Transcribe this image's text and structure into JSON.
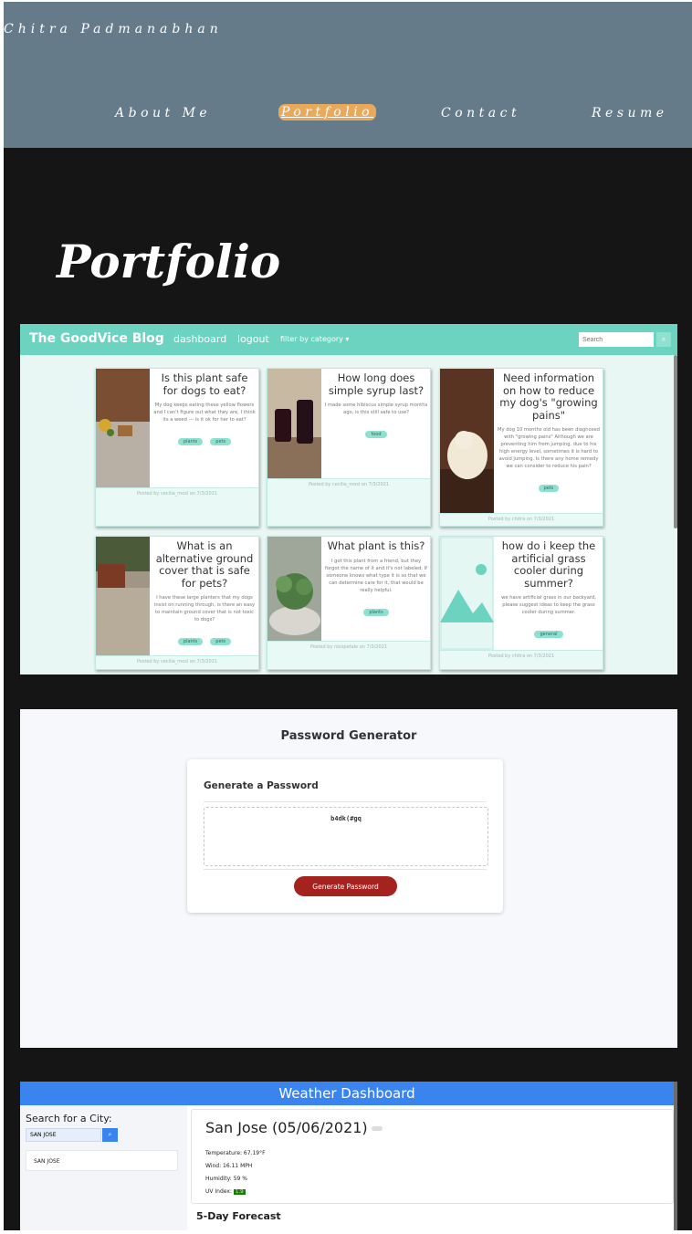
{
  "site": {
    "brand": "Chitra Padmanabhan",
    "nav": [
      "About Me",
      "Portfolio",
      "Contact",
      "Resume"
    ],
    "active_nav": "Portfolio",
    "page_title": "Portfolio",
    "colors": {
      "header_bg": "#667b8a",
      "page_bg": "#151515",
      "active_nav_bg": "#e8a95a"
    }
  },
  "blog_shot": {
    "brand": "The GoodVice Blog",
    "links": {
      "dashboard": "dashboard",
      "logout": "logout",
      "filter": "filter by category ▾"
    },
    "search_placeholder": "Search",
    "search_icon": "search-icon",
    "posts": [
      {
        "title": "Is this plant safe for dogs to eat?",
        "text": "My dog keeps eating these yellow flowers and I can't figure out what they are, I think its a weed --- is it ok for her to eat?",
        "tags": [
          "plants",
          "pets"
        ],
        "meta": "Posted by cecilia_mosl on 7/3/2021"
      },
      {
        "title": "How long does simple syrup last?",
        "text": "I made some hibiscus simple syrup months ago, is this still safe to use?",
        "tags": [
          "food"
        ],
        "meta": "Posted by cecilia_mosl on 7/3/2021"
      },
      {
        "title": "Need information on how to reduce my dog's \"growing pains\"",
        "text": "My dog 10 months old has been diagnosed with \"growing pains\" Although we are preventing him from jumping, due to his high energy level, sometimes it is hard to avoid jumping. Is there any home remedy we can consider to reduce his pain?",
        "tags": [
          "pets"
        ],
        "meta": "Posted by chitra on 7/3/2021"
      },
      {
        "title": "What is an alternative ground cover that is safe for pets?",
        "text": "I have these large planters that my dogs insist on running through, is there an easy to maintain ground cover that is not toxic to dogs?",
        "tags": [
          "plants",
          "pets"
        ],
        "meta": "Posted by cecilia_mosl on 7/3/2021"
      },
      {
        "title": "What plant is this?",
        "text": "I got this plant from a friend, but they forgot the name of it and it's not labeled. If someone knows what type it is so that we can determine care for it, that would be really helpful.",
        "tags": [
          "plants"
        ],
        "meta": "Posted by nicopetale on 7/3/2021"
      },
      {
        "title": "how do i keep the artificial grass cooler during summer?",
        "text": "we have artificial grass in our backyard, please suggest ideas to keep the grass cooler during summer.",
        "tags": [
          "general"
        ],
        "meta": "Posted by chitra on 7/3/2021"
      }
    ]
  },
  "password_shot": {
    "title": "Password Generator",
    "card_title": "Generate a Password",
    "password": "b4dk(#gq",
    "button": "Generate Password",
    "button_color": "#a4231f"
  },
  "weather_shot": {
    "title": "Weather Dashboard",
    "search_title": "Search for a City:",
    "search_value": "SAN JOSE",
    "search_icon": "search-icon",
    "history": [
      "SAN JOSE"
    ],
    "city_line": "San Jose (05/06/2021)",
    "weather_icon": "cloud-icon",
    "temperature": "Temperature: 67.19°F",
    "wind": "Wind: 16.11 MPH",
    "humidity": "Humidity: 59 %",
    "uv_label": "UV Index:",
    "uv_value": "1.9",
    "forecast_title": "5-Day Forecast",
    "accent": "#3a84f0"
  }
}
